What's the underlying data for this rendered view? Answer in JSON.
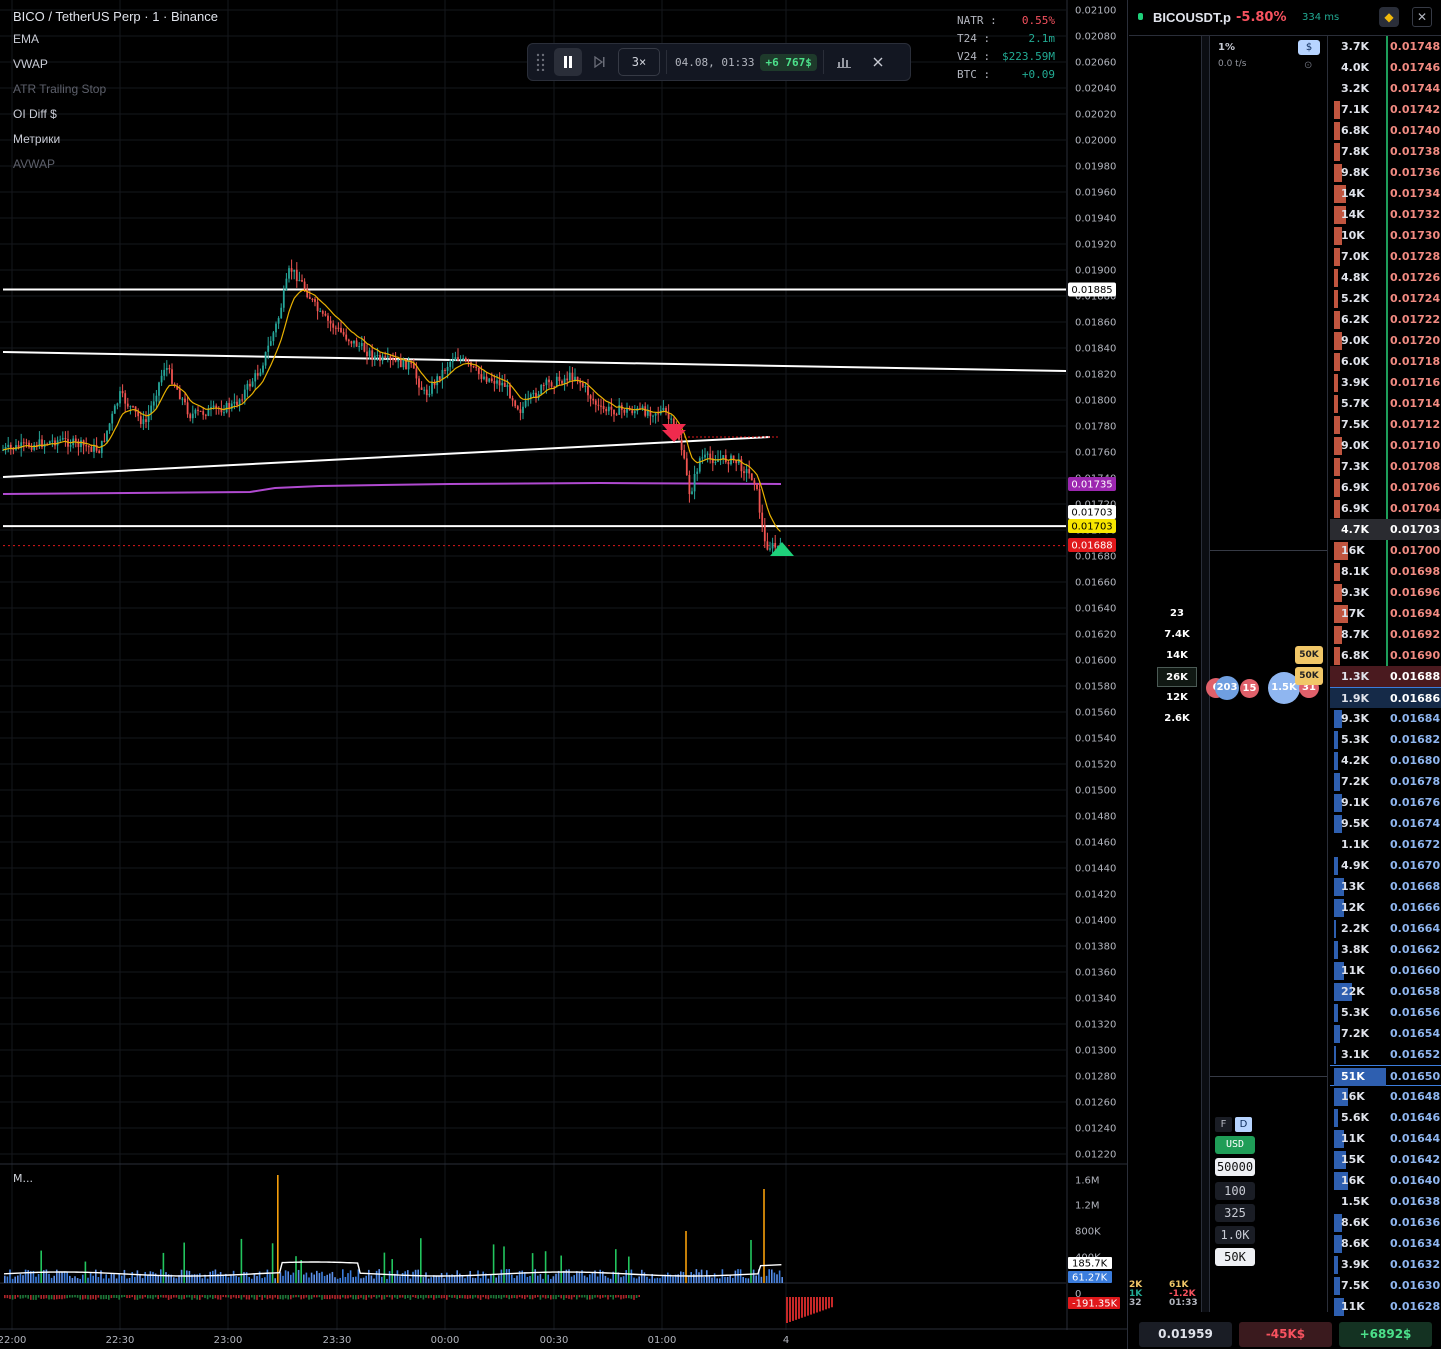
{
  "chart": {
    "title": "BICO / TetherUS Perp · 1 · Binance",
    "indicators": [
      {
        "label": "EMA",
        "dim": false
      },
      {
        "label": "VWAP",
        "dim": false
      },
      {
        "label": "ATR Trailing Stop",
        "dim": true
      },
      {
        "label": "OI Diff $",
        "dim": false
      },
      {
        "label": "Метрики",
        "dim": false
      },
      {
        "label": "AVWAP",
        "dim": true
      }
    ],
    "stats": [
      {
        "k": "NATR :",
        "v": "0.55%",
        "color": "#f7525f"
      },
      {
        "k": "T24 :",
        "v": "2.1m",
        "color": "#22ab94"
      },
      {
        "k": "V24 :",
        "v": "$223.59M",
        "color": "#22ab94"
      },
      {
        "k": "BTC :",
        "v": "+0.09",
        "color": "#22ab94"
      }
    ],
    "replay": {
      "speed": "3×",
      "datetime": "04.08, 01:33",
      "pnl": "+6 767$"
    },
    "price_axis": [
      "0.02100",
      "0.02080",
      "0.02060",
      "0.02040",
      "0.02020",
      "0.02000",
      "0.01980",
      "0.01960",
      "0.01940",
      "0.01920",
      "0.01900",
      "0.01880",
      "0.01860",
      "0.01840",
      "0.01820",
      "0.01800",
      "0.01780",
      "0.01760",
      "0.01740",
      "0.01720",
      "0.01700",
      "0.01680",
      "0.01660",
      "0.01640",
      "0.01620",
      "0.01600",
      "0.01580",
      "0.01560",
      "0.01540",
      "0.01520",
      "0.01500",
      "0.01480",
      "0.01460",
      "0.01440",
      "0.01420",
      "0.01400",
      "0.01380",
      "0.01360",
      "0.01340",
      "0.01320",
      "0.01300",
      "0.01280",
      "0.01260",
      "0.01240",
      "0.01220"
    ],
    "price_tags": [
      {
        "price": "0.01885",
        "bg": "#ffffff",
        "fg": "#000000"
      },
      {
        "price": "0.01735",
        "bg": "#9c27b0",
        "fg": "#ffffff"
      },
      {
        "price": "0.01703",
        "bg": "#ffffff",
        "fg": "#000000"
      },
      {
        "price": "0.01703",
        "bg": "#f7e600",
        "fg": "#000000"
      },
      {
        "price": "0.01688",
        "bg": "#e0181b",
        "fg": "#ffffff"
      }
    ],
    "time_axis": [
      "22:00",
      "22:30",
      "23:00",
      "23:30",
      "00:00",
      "00:30",
      "01:00",
      "4"
    ],
    "pane2": {
      "title": "M...",
      "axis": [
        "1.6M",
        "1.2M",
        "800K",
        "400K"
      ],
      "tags": [
        {
          "value": "185.7K",
          "bg": "#ffffff",
          "fg": "#000000"
        },
        {
          "value": "61.27K",
          "bg": "#3b7ddd",
          "fg": "#ffffff"
        },
        {
          "value": "-191.35K",
          "bg": "#e0181b",
          "fg": "#ffffff"
        }
      ],
      "zero": "0"
    },
    "colors": {
      "up": "#26a69a",
      "down": "#ef5350",
      "ema": "#e8b000",
      "vwap": "#b04ad0",
      "level": "#ffffff"
    }
  },
  "book": {
    "symbol": "BICOUSDT.p",
    "change": "-5.80%",
    "ping": "334 ms",
    "exchange_icon": "binance-icon",
    "pct": "1%",
    "tps": "0.0 t/s",
    "usd_toggle": "$",
    "volume_profile": [
      {
        "v": "23"
      },
      {
        "v": "7.4K"
      },
      {
        "v": "14K"
      },
      {
        "v": "26K",
        "sel": true
      },
      {
        "v": "12K"
      },
      {
        "v": "2.6K"
      }
    ],
    "bubbles": [
      {
        "v": "6",
        "color": "#e0606a"
      },
      {
        "v": "203",
        "color": "#6f9fe0"
      },
      {
        "v": "15",
        "color": "#e0606a"
      },
      {
        "v": "1.5K",
        "color": "#8fb6f0"
      },
      {
        "v": "31",
        "color": "#e0606a"
      }
    ],
    "big_tags": [
      "50K",
      "50K"
    ],
    "fd": [
      "F",
      "D"
    ],
    "controls": [
      {
        "label": "USD",
        "style": "usd"
      },
      {
        "label": "50000",
        "style": "white"
      },
      {
        "label": "100",
        "style": "plain"
      },
      {
        "label": "325",
        "style": "plain"
      },
      {
        "label": "1.0K",
        "style": "plain"
      },
      {
        "label": "50K",
        "style": "white"
      }
    ],
    "mini_stats": [
      {
        "a": "2K",
        "b": "61K",
        "ca": "#f1c768",
        "cb": "#f1c768"
      },
      {
        "a": "1K",
        "b": "-1.2K",
        "ca": "#22ab94",
        "cb": "#f7525f"
      },
      {
        "a": "32",
        "b": "01:33",
        "ca": "#b2b5be",
        "cb": "#b2b5be"
      }
    ],
    "ladder": [
      {
        "size": "3.7K",
        "price": "0.01748",
        "side": "ask",
        "bar": 0
      },
      {
        "size": "4.0K",
        "price": "0.01746",
        "side": "ask",
        "bar": 0
      },
      {
        "size": "3.2K",
        "price": "0.01744",
        "side": "ask",
        "bar": 0
      },
      {
        "size": "7.1K",
        "price": "0.01742",
        "side": "ask",
        "bar": 3
      },
      {
        "size": "6.8K",
        "price": "0.01740",
        "side": "ask",
        "bar": 3
      },
      {
        "size": "7.8K",
        "price": "0.01738",
        "side": "ask",
        "bar": 3
      },
      {
        "size": "9.8K",
        "price": "0.01736",
        "side": "ask",
        "bar": 4
      },
      {
        "size": "14K",
        "price": "0.01734",
        "side": "ask",
        "bar": 6
      },
      {
        "size": "14K",
        "price": "0.01732",
        "side": "ask",
        "bar": 6
      },
      {
        "size": "10K",
        "price": "0.01730",
        "side": "ask",
        "bar": 4
      },
      {
        "size": "7.0K",
        "price": "0.01728",
        "side": "ask",
        "bar": 3
      },
      {
        "size": "4.8K",
        "price": "0.01726",
        "side": "ask",
        "bar": 2
      },
      {
        "size": "5.2K",
        "price": "0.01724",
        "side": "ask",
        "bar": 2
      },
      {
        "size": "6.2K",
        "price": "0.01722",
        "side": "ask",
        "bar": 3
      },
      {
        "size": "9.0K",
        "price": "0.01720",
        "side": "ask",
        "bar": 4
      },
      {
        "size": "6.0K",
        "price": "0.01718",
        "side": "ask",
        "bar": 3
      },
      {
        "size": "3.9K",
        "price": "0.01716",
        "side": "ask",
        "bar": 2
      },
      {
        "size": "5.7K",
        "price": "0.01714",
        "side": "ask",
        "bar": 2
      },
      {
        "size": "7.5K",
        "price": "0.01712",
        "side": "ask",
        "bar": 3
      },
      {
        "size": "9.0K",
        "price": "0.01710",
        "side": "ask",
        "bar": 4
      },
      {
        "size": "7.3K",
        "price": "0.01708",
        "side": "ask",
        "bar": 3
      },
      {
        "size": "6.9K",
        "price": "0.01706",
        "side": "ask",
        "bar": 3
      },
      {
        "size": "6.9K",
        "price": "0.01704",
        "side": "ask",
        "bar": 3
      },
      {
        "size": "4.7K",
        "price": "0.01703",
        "side": "cur",
        "bar": 0
      },
      {
        "size": "16K",
        "price": "0.01700",
        "side": "ask",
        "bar": 7
      },
      {
        "size": "8.1K",
        "price": "0.01698",
        "side": "ask",
        "bar": 3
      },
      {
        "size": "9.3K",
        "price": "0.01696",
        "side": "ask",
        "bar": 4
      },
      {
        "size": "17K",
        "price": "0.01694",
        "side": "ask",
        "bar": 7
      },
      {
        "size": "8.7K",
        "price": "0.01692",
        "side": "ask",
        "bar": 4
      },
      {
        "size": "6.8K",
        "price": "0.01690",
        "side": "ask",
        "bar": 3
      },
      {
        "size": "1.3K",
        "price": "0.01688",
        "side": "last",
        "bar": 0
      },
      {
        "size": "1.9K",
        "price": "0.01686",
        "side": "bidtop",
        "bar": 0
      },
      {
        "size": "9.3K",
        "price": "0.01684",
        "side": "bid",
        "bar": 4
      },
      {
        "size": "5.3K",
        "price": "0.01682",
        "side": "bid",
        "bar": 2
      },
      {
        "size": "4.2K",
        "price": "0.01680",
        "side": "bid",
        "bar": 2
      },
      {
        "size": "7.2K",
        "price": "0.01678",
        "side": "bid",
        "bar": 3
      },
      {
        "size": "9.1K",
        "price": "0.01676",
        "side": "bid",
        "bar": 4
      },
      {
        "size": "9.5K",
        "price": "0.01674",
        "side": "bid",
        "bar": 4
      },
      {
        "size": "1.1K",
        "price": "0.01672",
        "side": "bid",
        "bar": 0
      },
      {
        "size": "4.9K",
        "price": "0.01670",
        "side": "bid",
        "bar": 2
      },
      {
        "size": "13K",
        "price": "0.01668",
        "side": "bid",
        "bar": 5
      },
      {
        "size": "12K",
        "price": "0.01666",
        "side": "bid",
        "bar": 5
      },
      {
        "size": "2.2K",
        "price": "0.01664",
        "side": "bid",
        "bar": 1
      },
      {
        "size": "3.8K",
        "price": "0.01662",
        "side": "bid",
        "bar": 2
      },
      {
        "size": "11K",
        "price": "0.01660",
        "side": "bid",
        "bar": 5
      },
      {
        "size": "22K",
        "price": "0.01658",
        "side": "bid",
        "bar": 9
      },
      {
        "size": "5.3K",
        "price": "0.01656",
        "side": "bid",
        "bar": 2
      },
      {
        "size": "7.2K",
        "price": "0.01654",
        "side": "bid",
        "bar": 3
      },
      {
        "size": "3.1K",
        "price": "0.01652",
        "side": "bid",
        "bar": 1
      },
      {
        "size": "51K",
        "price": "0.01650",
        "side": "bidbig",
        "bar": 20
      },
      {
        "size": "16K",
        "price": "0.01648",
        "side": "bid",
        "bar": 7
      },
      {
        "size": "5.6K",
        "price": "0.01646",
        "side": "bid",
        "bar": 2
      },
      {
        "size": "11K",
        "price": "0.01644",
        "side": "bid",
        "bar": 5
      },
      {
        "size": "15K",
        "price": "0.01642",
        "side": "bid",
        "bar": 6
      },
      {
        "size": "16K",
        "price": "0.01640",
        "side": "bid",
        "bar": 7
      },
      {
        "size": "1.5K",
        "price": "0.01638",
        "side": "bid",
        "bar": 0
      },
      {
        "size": "8.6K",
        "price": "0.01636",
        "side": "bid",
        "bar": 4
      },
      {
        "size": "8.6K",
        "price": "0.01634",
        "side": "bid",
        "bar": 4
      },
      {
        "size": "3.9K",
        "price": "0.01632",
        "side": "bid",
        "bar": 2
      },
      {
        "size": "7.5K",
        "price": "0.01630",
        "side": "bid",
        "bar": 3
      },
      {
        "size": "11K",
        "price": "0.01628",
        "side": "bid",
        "bar": 5
      }
    ],
    "footer": {
      "price": "0.01959",
      "loss": "-45K$",
      "gain": "+6892$"
    }
  }
}
